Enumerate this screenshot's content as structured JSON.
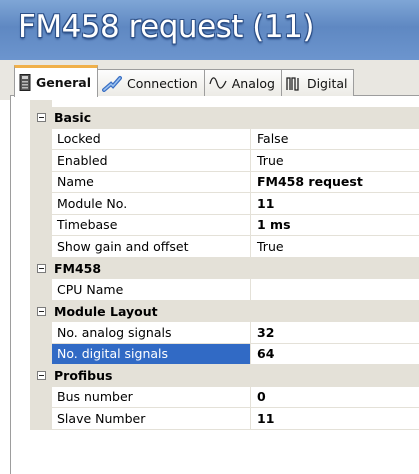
{
  "window": {
    "title": "FM458 request (11)"
  },
  "tabs": [
    {
      "label": "General",
      "icon": "module-icon",
      "active": true
    },
    {
      "label": "Connection",
      "icon": "connection-icon",
      "active": false
    },
    {
      "label": "Analog",
      "icon": "analog-wave-icon",
      "active": false
    },
    {
      "label": "Digital",
      "icon": "digital-signal-icon",
      "active": false
    }
  ],
  "properties": {
    "basic": {
      "label": "Basic",
      "rows": [
        {
          "name": "Locked",
          "value": "False"
        },
        {
          "name": "Enabled",
          "value": "True"
        },
        {
          "name": "Name",
          "value": "FM458 request"
        },
        {
          "name": "Module No.",
          "value": "11"
        },
        {
          "name": "Timebase",
          "value": "1 ms"
        },
        {
          "name": "Show gain and offset",
          "value": "True"
        }
      ]
    },
    "fm458": {
      "label": "FM458",
      "rows": [
        {
          "name": "CPU Name",
          "value": ""
        }
      ]
    },
    "module_layout": {
      "label": "Module Layout",
      "rows": [
        {
          "name": "No. analog signals",
          "value": "32"
        },
        {
          "name": "No. digital signals",
          "value": "64"
        }
      ]
    },
    "profibus": {
      "label": "Profibus",
      "rows": [
        {
          "name": "Bus number",
          "value": "0"
        },
        {
          "name": "Slave Number",
          "value": "11"
        }
      ]
    }
  },
  "selected_property": "No. digital signals",
  "colors": {
    "title_bar": "#6c95ce",
    "active_tab_accent": "#f0b04a",
    "category_bg": "#e4e1d8",
    "selection": "#316ac5"
  }
}
